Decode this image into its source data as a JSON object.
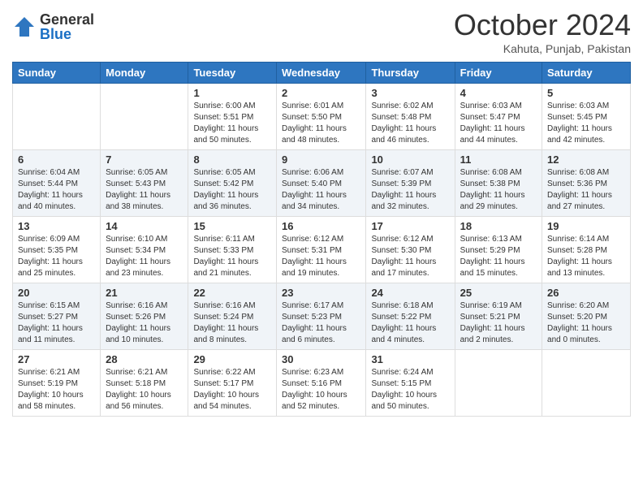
{
  "header": {
    "logo_general": "General",
    "logo_blue": "Blue",
    "month_title": "October 2024",
    "location": "Kahuta, Punjab, Pakistan"
  },
  "weekdays": [
    "Sunday",
    "Monday",
    "Tuesday",
    "Wednesday",
    "Thursday",
    "Friday",
    "Saturday"
  ],
  "weeks": [
    [
      {
        "day": "",
        "sunrise": "",
        "sunset": "",
        "daylight": ""
      },
      {
        "day": "",
        "sunrise": "",
        "sunset": "",
        "daylight": ""
      },
      {
        "day": "1",
        "sunrise": "Sunrise: 6:00 AM",
        "sunset": "Sunset: 5:51 PM",
        "daylight": "Daylight: 11 hours and 50 minutes."
      },
      {
        "day": "2",
        "sunrise": "Sunrise: 6:01 AM",
        "sunset": "Sunset: 5:50 PM",
        "daylight": "Daylight: 11 hours and 48 minutes."
      },
      {
        "day": "3",
        "sunrise": "Sunrise: 6:02 AM",
        "sunset": "Sunset: 5:48 PM",
        "daylight": "Daylight: 11 hours and 46 minutes."
      },
      {
        "day": "4",
        "sunrise": "Sunrise: 6:03 AM",
        "sunset": "Sunset: 5:47 PM",
        "daylight": "Daylight: 11 hours and 44 minutes."
      },
      {
        "day": "5",
        "sunrise": "Sunrise: 6:03 AM",
        "sunset": "Sunset: 5:45 PM",
        "daylight": "Daylight: 11 hours and 42 minutes."
      }
    ],
    [
      {
        "day": "6",
        "sunrise": "Sunrise: 6:04 AM",
        "sunset": "Sunset: 5:44 PM",
        "daylight": "Daylight: 11 hours and 40 minutes."
      },
      {
        "day": "7",
        "sunrise": "Sunrise: 6:05 AM",
        "sunset": "Sunset: 5:43 PM",
        "daylight": "Daylight: 11 hours and 38 minutes."
      },
      {
        "day": "8",
        "sunrise": "Sunrise: 6:05 AM",
        "sunset": "Sunset: 5:42 PM",
        "daylight": "Daylight: 11 hours and 36 minutes."
      },
      {
        "day": "9",
        "sunrise": "Sunrise: 6:06 AM",
        "sunset": "Sunset: 5:40 PM",
        "daylight": "Daylight: 11 hours and 34 minutes."
      },
      {
        "day": "10",
        "sunrise": "Sunrise: 6:07 AM",
        "sunset": "Sunset: 5:39 PM",
        "daylight": "Daylight: 11 hours and 32 minutes."
      },
      {
        "day": "11",
        "sunrise": "Sunrise: 6:08 AM",
        "sunset": "Sunset: 5:38 PM",
        "daylight": "Daylight: 11 hours and 29 minutes."
      },
      {
        "day": "12",
        "sunrise": "Sunrise: 6:08 AM",
        "sunset": "Sunset: 5:36 PM",
        "daylight": "Daylight: 11 hours and 27 minutes."
      }
    ],
    [
      {
        "day": "13",
        "sunrise": "Sunrise: 6:09 AM",
        "sunset": "Sunset: 5:35 PM",
        "daylight": "Daylight: 11 hours and 25 minutes."
      },
      {
        "day": "14",
        "sunrise": "Sunrise: 6:10 AM",
        "sunset": "Sunset: 5:34 PM",
        "daylight": "Daylight: 11 hours and 23 minutes."
      },
      {
        "day": "15",
        "sunrise": "Sunrise: 6:11 AM",
        "sunset": "Sunset: 5:33 PM",
        "daylight": "Daylight: 11 hours and 21 minutes."
      },
      {
        "day": "16",
        "sunrise": "Sunrise: 6:12 AM",
        "sunset": "Sunset: 5:31 PM",
        "daylight": "Daylight: 11 hours and 19 minutes."
      },
      {
        "day": "17",
        "sunrise": "Sunrise: 6:12 AM",
        "sunset": "Sunset: 5:30 PM",
        "daylight": "Daylight: 11 hours and 17 minutes."
      },
      {
        "day": "18",
        "sunrise": "Sunrise: 6:13 AM",
        "sunset": "Sunset: 5:29 PM",
        "daylight": "Daylight: 11 hours and 15 minutes."
      },
      {
        "day": "19",
        "sunrise": "Sunrise: 6:14 AM",
        "sunset": "Sunset: 5:28 PM",
        "daylight": "Daylight: 11 hours and 13 minutes."
      }
    ],
    [
      {
        "day": "20",
        "sunrise": "Sunrise: 6:15 AM",
        "sunset": "Sunset: 5:27 PM",
        "daylight": "Daylight: 11 hours and 11 minutes."
      },
      {
        "day": "21",
        "sunrise": "Sunrise: 6:16 AM",
        "sunset": "Sunset: 5:26 PM",
        "daylight": "Daylight: 11 hours and 10 minutes."
      },
      {
        "day": "22",
        "sunrise": "Sunrise: 6:16 AM",
        "sunset": "Sunset: 5:24 PM",
        "daylight": "Daylight: 11 hours and 8 minutes."
      },
      {
        "day": "23",
        "sunrise": "Sunrise: 6:17 AM",
        "sunset": "Sunset: 5:23 PM",
        "daylight": "Daylight: 11 hours and 6 minutes."
      },
      {
        "day": "24",
        "sunrise": "Sunrise: 6:18 AM",
        "sunset": "Sunset: 5:22 PM",
        "daylight": "Daylight: 11 hours and 4 minutes."
      },
      {
        "day": "25",
        "sunrise": "Sunrise: 6:19 AM",
        "sunset": "Sunset: 5:21 PM",
        "daylight": "Daylight: 11 hours and 2 minutes."
      },
      {
        "day": "26",
        "sunrise": "Sunrise: 6:20 AM",
        "sunset": "Sunset: 5:20 PM",
        "daylight": "Daylight: 11 hours and 0 minutes."
      }
    ],
    [
      {
        "day": "27",
        "sunrise": "Sunrise: 6:21 AM",
        "sunset": "Sunset: 5:19 PM",
        "daylight": "Daylight: 10 hours and 58 minutes."
      },
      {
        "day": "28",
        "sunrise": "Sunrise: 6:21 AM",
        "sunset": "Sunset: 5:18 PM",
        "daylight": "Daylight: 10 hours and 56 minutes."
      },
      {
        "day": "29",
        "sunrise": "Sunrise: 6:22 AM",
        "sunset": "Sunset: 5:17 PM",
        "daylight": "Daylight: 10 hours and 54 minutes."
      },
      {
        "day": "30",
        "sunrise": "Sunrise: 6:23 AM",
        "sunset": "Sunset: 5:16 PM",
        "daylight": "Daylight: 10 hours and 52 minutes."
      },
      {
        "day": "31",
        "sunrise": "Sunrise: 6:24 AM",
        "sunset": "Sunset: 5:15 PM",
        "daylight": "Daylight: 10 hours and 50 minutes."
      },
      {
        "day": "",
        "sunrise": "",
        "sunset": "",
        "daylight": ""
      },
      {
        "day": "",
        "sunrise": "",
        "sunset": "",
        "daylight": ""
      }
    ]
  ]
}
